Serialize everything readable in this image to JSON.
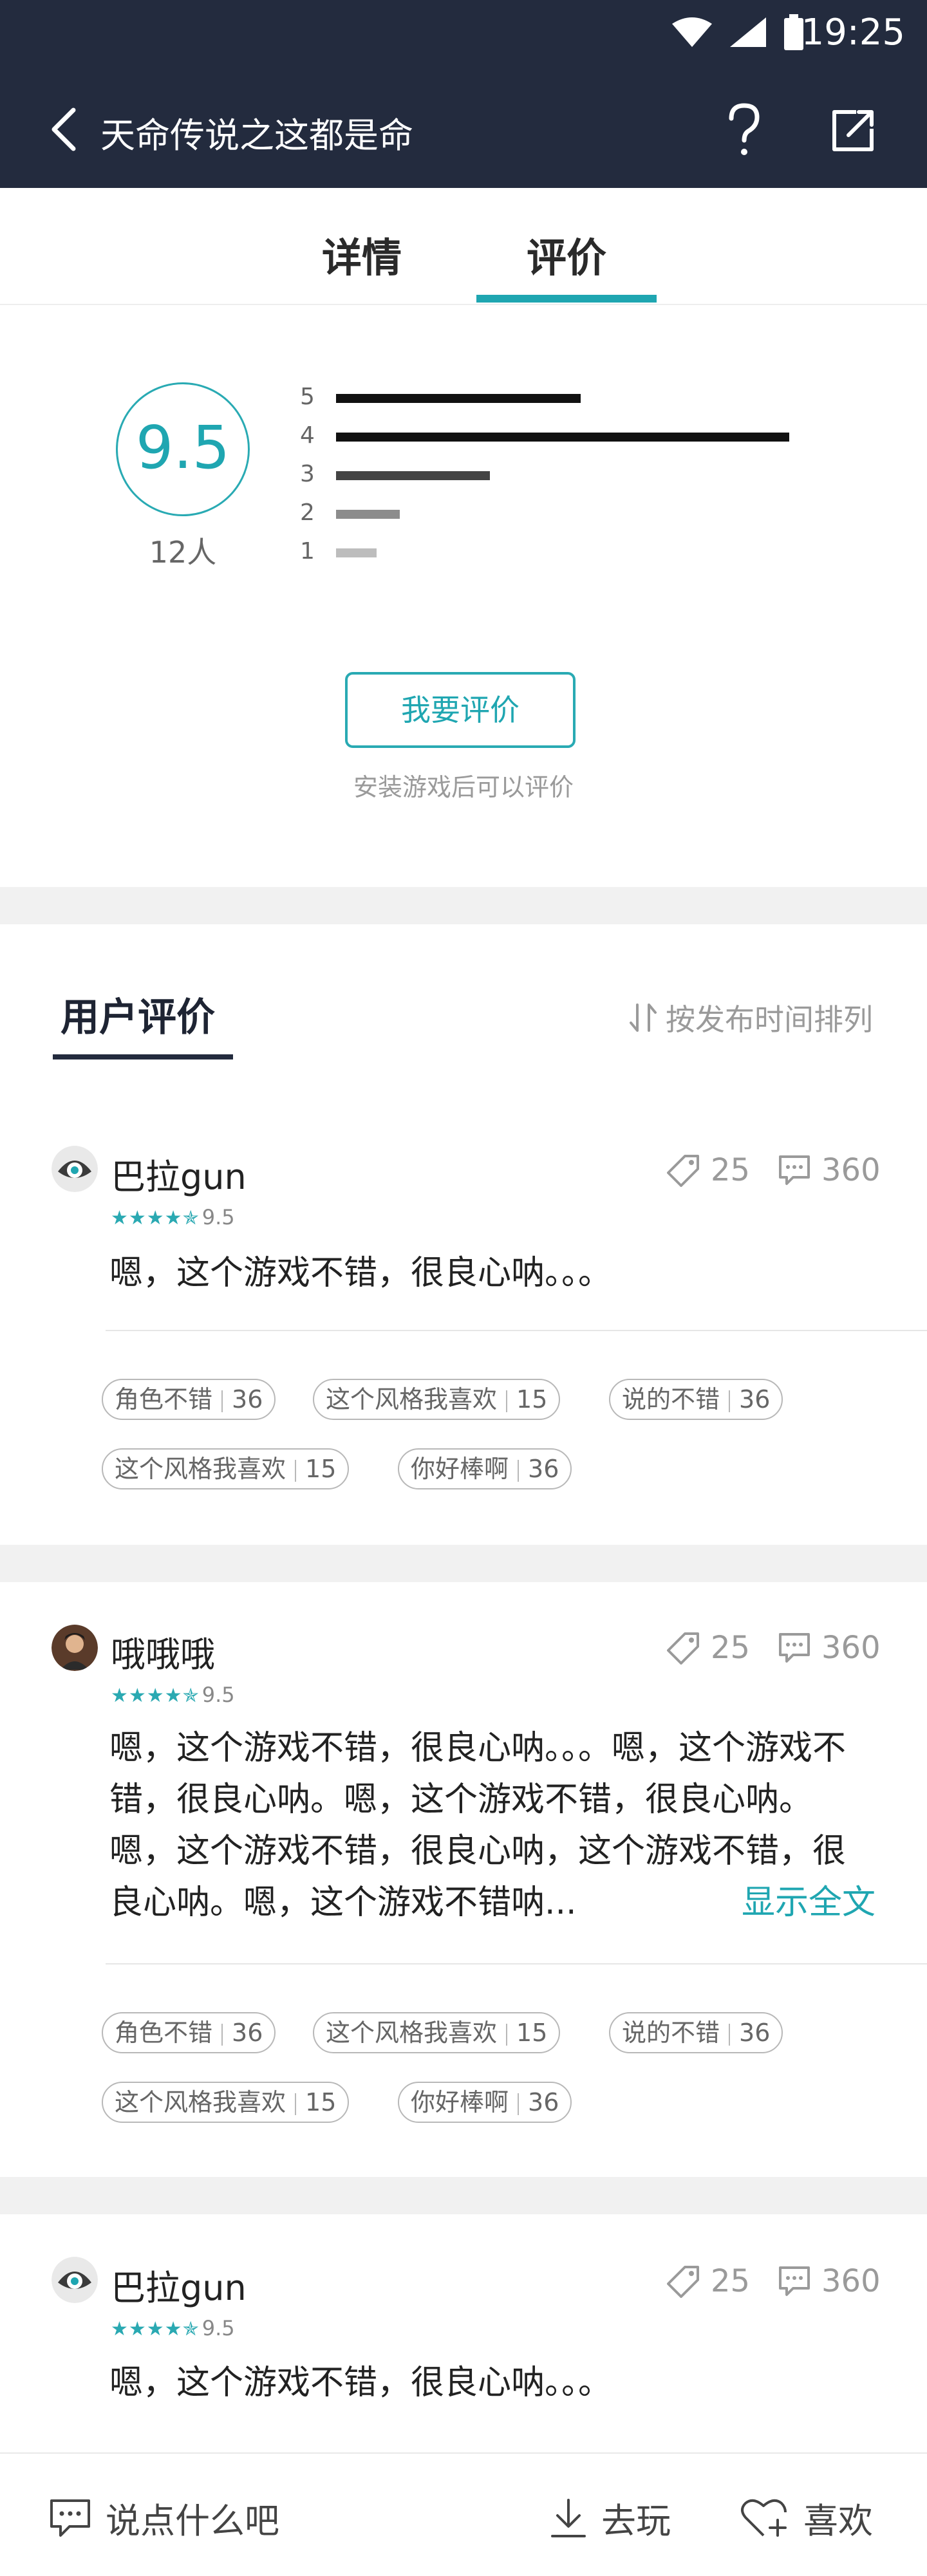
{
  "status_bar": {
    "time": "19:25"
  },
  "header": {
    "title": "天命传说之这都是命"
  },
  "tabs": [
    {
      "label": "详情"
    },
    {
      "label": "评价"
    }
  ],
  "rating": {
    "score": "9.5",
    "count_label": "12人",
    "distribution": [
      {
        "star": "5",
        "fraction": 0.54
      },
      {
        "star": "4",
        "fraction": 1.0
      },
      {
        "star": "3",
        "fraction": 0.34
      },
      {
        "star": "2",
        "fraction": 0.14
      },
      {
        "star": "1",
        "fraction": 0.09
      }
    ],
    "rate_button": "我要评价",
    "rate_hint": "安装游戏后可以评价"
  },
  "reviews_section": {
    "title": "用户评价",
    "sort_label": "按发布时间排列"
  },
  "reviews": [
    {
      "username": "巴拉gun",
      "stars": "★★★★✯",
      "score": "9.5",
      "likes": "25",
      "comments": "360",
      "text": "嗯，这个游戏不错，很良心呐。。。",
      "tags": [
        {
          "label": "角色不错",
          "count": "36"
        },
        {
          "label": "这个风格我喜欢",
          "count": "15"
        },
        {
          "label": "说的不错",
          "count": "36"
        },
        {
          "label": "这个风格我喜欢",
          "count": "15"
        },
        {
          "label": "你好棒啊",
          "count": "36"
        }
      ]
    },
    {
      "username": "哦哦哦",
      "stars": "★★★★✯",
      "score": "9.5",
      "likes": "25",
      "comments": "360",
      "text": "嗯，这个游戏不错，很良心呐。。。嗯，这个游戏不错，很良心呐。嗯，这个游戏不错，很良心呐。嗯，这个游戏不错，很良心呐，这个游戏不错，很良心呐。嗯，这个游戏不错呐...",
      "show_all": "显示全文",
      "tags": [
        {
          "label": "角色不错",
          "count": "36"
        },
        {
          "label": "这个风格我喜欢",
          "count": "15"
        },
        {
          "label": "说的不错",
          "count": "36"
        },
        {
          "label": "这个风格我喜欢",
          "count": "15"
        },
        {
          "label": "你好棒啊",
          "count": "36"
        }
      ]
    },
    {
      "username": "巴拉gun",
      "stars": "★★★★✯",
      "score": "9.5",
      "likes": "25",
      "comments": "360",
      "text": "嗯，这个游戏不错，很良心呐。。。"
    }
  ],
  "bottom_bar": {
    "comment_placeholder": "说点什么吧",
    "play_label": "去玩",
    "like_label": "喜欢"
  },
  "colors": {
    "accent": "#1fa6b1",
    "header_bg": "#232b3e",
    "gap_bg": "#f1f1f1"
  }
}
